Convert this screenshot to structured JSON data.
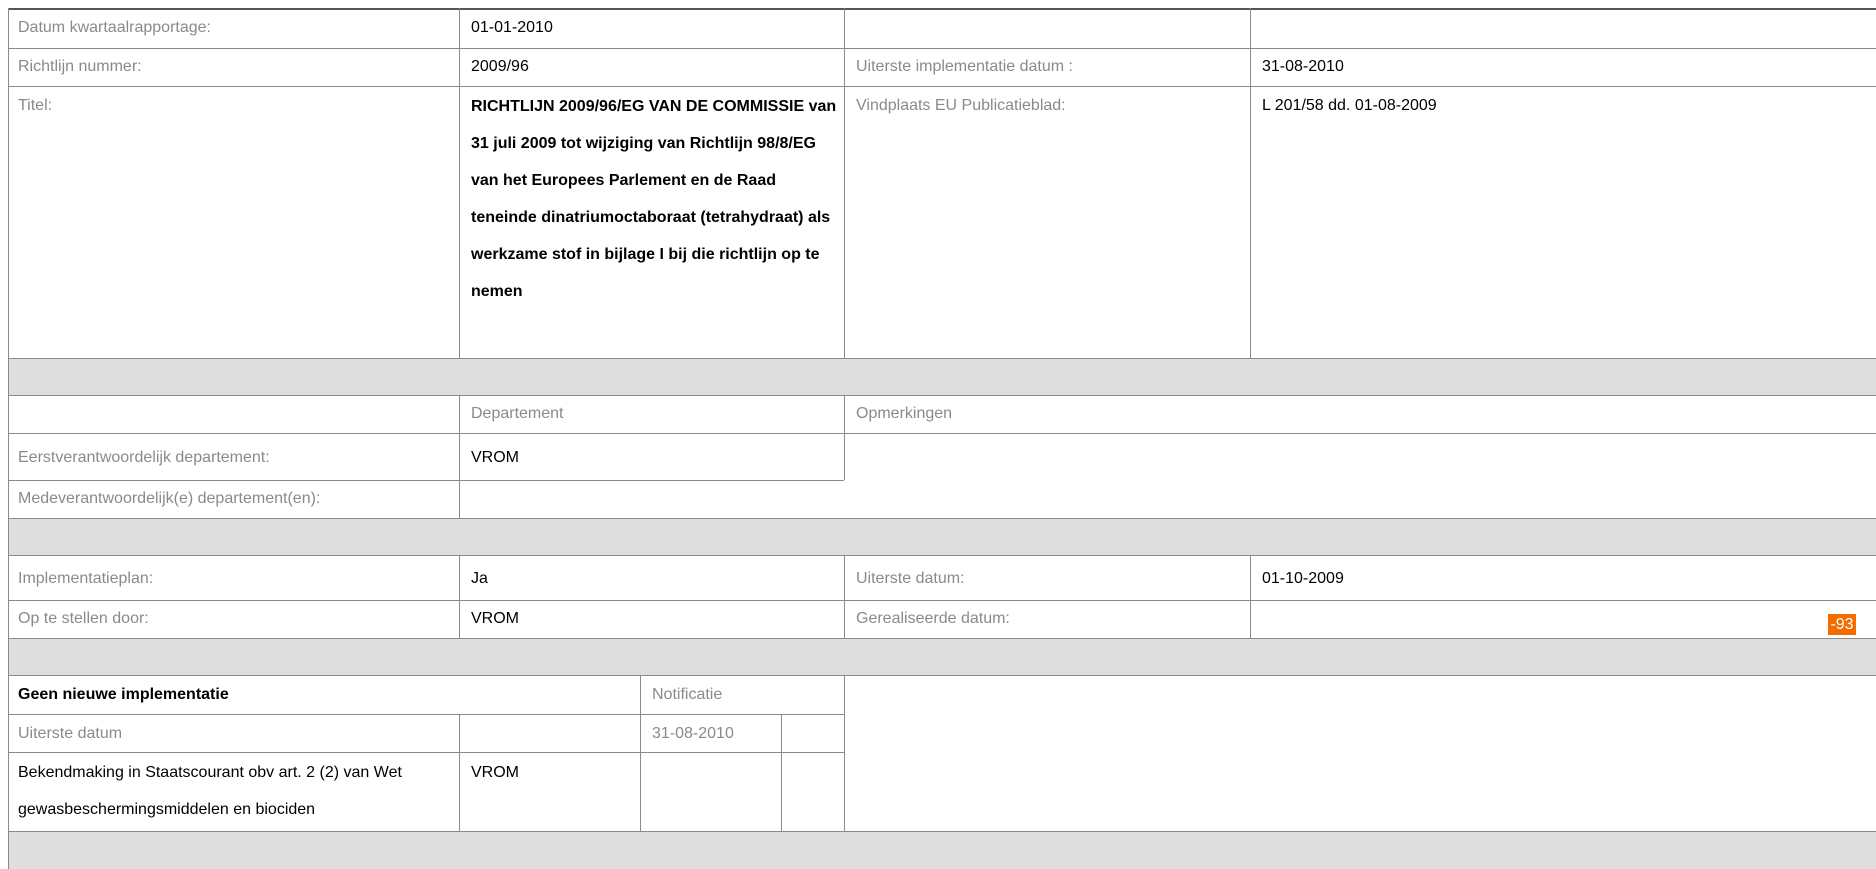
{
  "colors": {
    "label": "#8a8a8a",
    "value": "#000000",
    "band": "#dedede",
    "badge": "#f36c00",
    "grid": "#8a8a8a"
  },
  "rows": {
    "datum_label": "Datum kwartaalrapportage:",
    "datum_value": "01-01-2010",
    "richtlijn_label": "Richtlijn nummer:",
    "richtlijn_value": "2009/96",
    "uiterste_impl_label": "Uiterste implementatie datum :",
    "uiterste_impl_value": "31-08-2010",
    "titel_label": "Titel:",
    "titel_value": "RICHTLIJN 2009/96/EG VAN DE COMMISSIE van 31 juli 2009 tot wijziging van Richtlijn 98/8/EG van het Europees Parlement en de Raad teneinde dinatriumoctaboraat (tetrahydraat) als werkzame stof in bijlage I bij die richtlijn op te nemen",
    "vindplaats_label": "Vindplaats EU Publicatieblad:",
    "vindplaats_value": "L 201/58 dd. 01-08-2009"
  },
  "departments": {
    "col_departement": "Departement",
    "col_opmerkingen": "Opmerkingen",
    "eerst_label": "Eerstverantwoordelijk departement:",
    "eerst_value": "VROM",
    "mede_label": "Medeverantwoordelijk(e) departement(en):",
    "mede_value": ""
  },
  "plan": {
    "impl_label": "Implementatieplan:",
    "impl_value": "Ja",
    "uiterste_label": "Uiterste datum:",
    "uiterste_value": "01-10-2009",
    "door_label": "Op te stellen door:",
    "door_value": "VROM",
    "gerealiseerd_label": "Gerealiseerde datum:",
    "gerealiseerd_value": "",
    "badge": "-93"
  },
  "notification": {
    "header": "Geen nieuwe implementatie",
    "notificatie_label": "Notificatie",
    "uiterste_label": "Uiterste datum",
    "uiterste_value": "31-08-2010",
    "bekendmaking": "Bekendmaking in Staatscourant obv art. 2 (2) van Wet gewasbeschermingsmiddelen en biociden",
    "bekendmaking_dept": "VROM"
  }
}
